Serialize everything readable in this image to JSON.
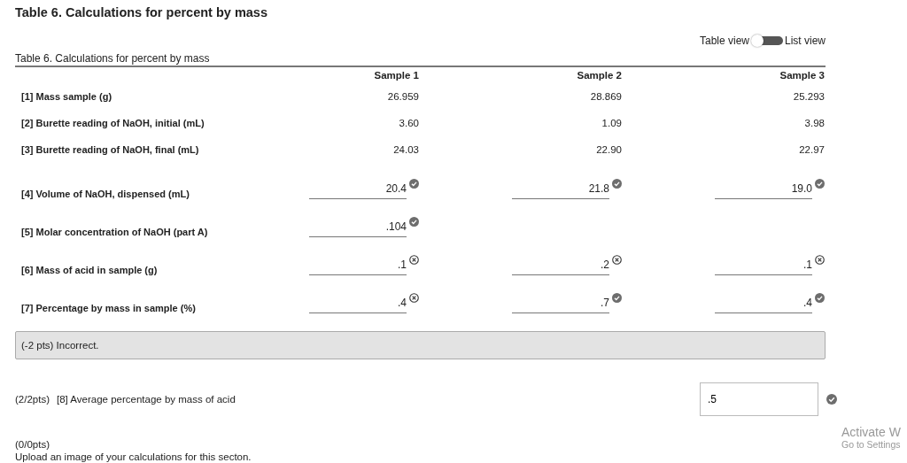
{
  "page_title": "Table 6. Calculations for percent by mass",
  "view_toggle": {
    "left_label": "Table view",
    "right_label": "List view",
    "on": false
  },
  "table": {
    "caption": "Table 6. Calculations for percent by mass",
    "columns": [
      "Sample 1",
      "Sample 2",
      "Sample 3"
    ],
    "rows": [
      {
        "label": "[1] Mass sample (g)",
        "cells": [
          {
            "kind": "text",
            "value": "26.959"
          },
          {
            "kind": "text",
            "value": "28.869"
          },
          {
            "kind": "text",
            "value": "25.293"
          }
        ]
      },
      {
        "label": "[2] Burette reading of NaOH, initial (mL)",
        "cells": [
          {
            "kind": "text",
            "value": "3.60"
          },
          {
            "kind": "text",
            "value": "1.09"
          },
          {
            "kind": "text",
            "value": "3.98"
          }
        ]
      },
      {
        "label": "[3] Burette reading of NaOH, final (mL)",
        "cells": [
          {
            "kind": "text",
            "value": "24.03"
          },
          {
            "kind": "text",
            "value": "22.90"
          },
          {
            "kind": "text",
            "value": "22.97"
          }
        ]
      },
      {
        "label": "[4] Volume of NaOH, dispensed (mL)",
        "cells": [
          {
            "kind": "input",
            "value": "20.4",
            "correct": true
          },
          {
            "kind": "input",
            "value": "21.8",
            "correct": true
          },
          {
            "kind": "input",
            "value": "19.0",
            "correct": true
          }
        ]
      },
      {
        "label": "[5] Molar concentration of NaOH (part A)",
        "cells": [
          {
            "kind": "input",
            "value": ".104",
            "correct": true
          },
          {
            "kind": "empty"
          },
          {
            "kind": "empty"
          }
        ]
      },
      {
        "label": "[6] Mass of acid in sample (g)",
        "cells": [
          {
            "kind": "input",
            "value": ".1",
            "correct": false
          },
          {
            "kind": "input",
            "value": ".2",
            "correct": false
          },
          {
            "kind": "input",
            "value": ".1",
            "correct": false
          }
        ]
      },
      {
        "label": "[7] Percentage by mass in sample (%)",
        "cells": [
          {
            "kind": "input",
            "value": ".4",
            "correct": false
          },
          {
            "kind": "input",
            "value": ".7",
            "correct": true
          },
          {
            "kind": "input",
            "value": ".4",
            "correct": true
          }
        ]
      }
    ]
  },
  "feedback": "(-2 pts) Incorrect.",
  "average": {
    "points": "(2/2pts)",
    "label": "[8] Average percentage by mass of acid",
    "value": ".5",
    "correct": true
  },
  "upload": {
    "points": "(0/0pts)",
    "label": "Upload an image of your calculations for this secton."
  },
  "os_notice": {
    "title": "Activate W",
    "subtitle": "Go to Settings"
  }
}
